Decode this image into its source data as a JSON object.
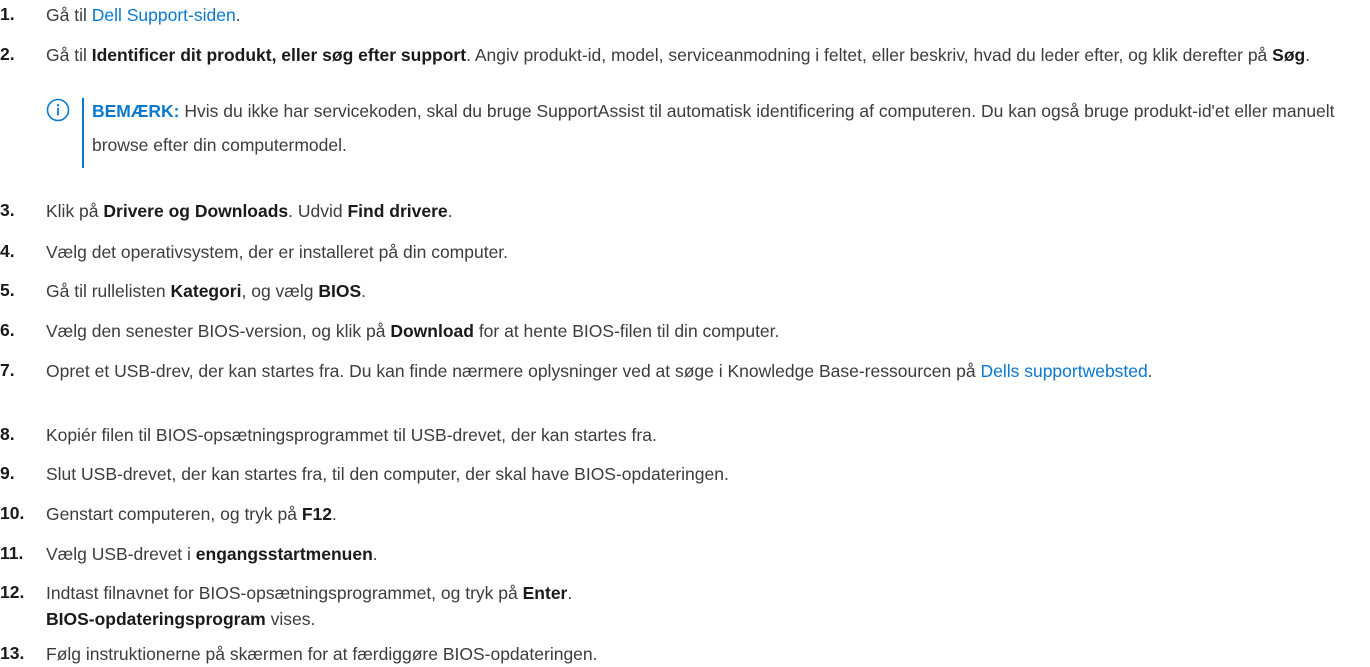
{
  "steps": [
    {
      "num": "1.",
      "parts": [
        {
          "t": "Gå til ",
          "s": "norm"
        },
        {
          "t": "Dell Support-siden",
          "s": "link"
        },
        {
          "t": ".",
          "s": "norm"
        }
      ]
    },
    {
      "num": "2.",
      "parts": [
        {
          "t": "Gå til ",
          "s": "norm"
        },
        {
          "t": "Identificer dit produkt, eller søg efter support",
          "s": "bold"
        },
        {
          "t": ". Angiv produkt-id, model, serviceanmodning i feltet, eller beskriv, hvad du leder efter, og klik derefter på ",
          "s": "norm"
        },
        {
          "t": "Søg",
          "s": "bold"
        },
        {
          "t": ".",
          "s": "norm"
        }
      ]
    },
    {
      "num": "3.",
      "parts": [
        {
          "t": "Klik på ",
          "s": "norm"
        },
        {
          "t": "Drivere og Downloads",
          "s": "bold"
        },
        {
          "t": ". Udvid ",
          "s": "norm"
        },
        {
          "t": "Find drivere",
          "s": "bold"
        },
        {
          "t": ".",
          "s": "norm"
        }
      ]
    },
    {
      "num": "4.",
      "parts": [
        {
          "t": "Vælg det operativsystem, der er installeret på din computer.",
          "s": "norm"
        }
      ]
    },
    {
      "num": "5.",
      "parts": [
        {
          "t": "Gå til rullelisten ",
          "s": "norm"
        },
        {
          "t": "Kategori",
          "s": "bold"
        },
        {
          "t": ", og vælg ",
          "s": "norm"
        },
        {
          "t": "BIOS",
          "s": "bold"
        },
        {
          "t": ".",
          "s": "norm"
        }
      ]
    },
    {
      "num": "6.",
      "parts": [
        {
          "t": "Vælg den senester BIOS-version, og klik på ",
          "s": "norm"
        },
        {
          "t": "Download",
          "s": "bold"
        },
        {
          "t": " for at hente BIOS-filen til din computer.",
          "s": "norm"
        }
      ]
    },
    {
      "num": "7.",
      "parts": [
        {
          "t": "Opret et USB-drev, der kan startes fra. Du kan finde nærmere oplysninger ved at søge i Knowledge Base-ressourcen på ",
          "s": "norm"
        },
        {
          "t": "Dells supportwebsted",
          "s": "link"
        },
        {
          "t": ".",
          "s": "norm"
        }
      ]
    },
    {
      "num": "8.",
      "parts": [
        {
          "t": "Kopiér filen til BIOS-opsætningsprogrammet til USB-drevet, der kan startes fra.",
          "s": "norm"
        }
      ]
    },
    {
      "num": "9.",
      "parts": [
        {
          "t": "Slut USB-drevet, der kan startes fra, til den computer, der skal have BIOS-opdateringen.",
          "s": "norm"
        }
      ]
    },
    {
      "num": "10.",
      "parts": [
        {
          "t": "Genstart computeren, og tryk på ",
          "s": "norm"
        },
        {
          "t": "F12",
          "s": "bold"
        },
        {
          "t": ".",
          "s": "norm"
        }
      ]
    },
    {
      "num": "11.",
      "parts": [
        {
          "t": "Vælg USB-drevet i ",
          "s": "norm"
        },
        {
          "t": "engangsstartmenuen",
          "s": "bold"
        },
        {
          "t": ".",
          "s": "norm"
        }
      ]
    },
    {
      "num": "12.",
      "parts": [
        {
          "t": "Indtast filnavnet for BIOS-opsætningsprogrammet, og tryk på ",
          "s": "norm"
        },
        {
          "t": "Enter",
          "s": "bold"
        },
        {
          "t": ".",
          "s": "norm"
        },
        {
          "t": "\n",
          "s": "br"
        },
        {
          "t": "BIOS-opdateringsprogram",
          "s": "bold"
        },
        {
          "t": " vises.",
          "s": "norm"
        }
      ]
    },
    {
      "num": "13.",
      "parts": [
        {
          "t": "Følg instruktionerne på skærmen for at færdiggøre BIOS-opdateringen.",
          "s": "norm"
        }
      ]
    }
  ],
  "note": {
    "label": "BEMÆRK:",
    "text": " Hvis du ikke har servicekoden, skal du bruge SupportAssist til automatisk identificering af computeren. Du kan også bruge produkt-id'et eller manuelt browse efter din computermodel.",
    "icon": "info-icon"
  },
  "colors": {
    "text": "#3c3c3c",
    "bold": "#1a1a1a",
    "link": "#0b78d0",
    "accent": "#0b78d0"
  }
}
